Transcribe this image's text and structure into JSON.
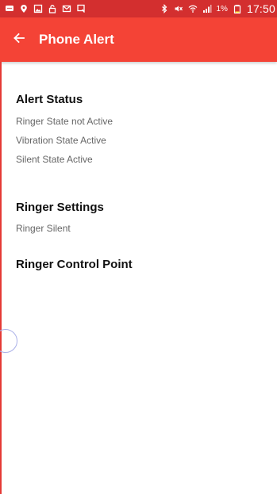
{
  "status_bar": {
    "time": "17:50",
    "battery_percent": "1%",
    "left_icons": [
      "message-icon",
      "location-icon",
      "image-icon",
      "lock-icon",
      "mail-icon",
      "cast-icon"
    ],
    "right_icons": [
      "bluetooth-icon",
      "mute-icon",
      "wifi-icon",
      "signal-icon",
      "battery-icon"
    ]
  },
  "app_bar": {
    "title": "Phone Alert",
    "back_icon": "arrow-left-icon"
  },
  "sections": {
    "alert_status": {
      "title": "Alert Status",
      "lines": [
        "Ringer State not Active",
        "Vibration State Active",
        "Silent State Active"
      ]
    },
    "ringer_settings": {
      "title": "Ringer Settings",
      "lines": [
        "Ringer Silent"
      ]
    },
    "ringer_control_point": {
      "title": "Ringer Control Point"
    }
  },
  "colors": {
    "status_bar": "#d32f2f",
    "app_bar": "#f44336",
    "accent_left_border": "#e53935",
    "title_text": "#111111",
    "secondary_text": "#666666"
  }
}
